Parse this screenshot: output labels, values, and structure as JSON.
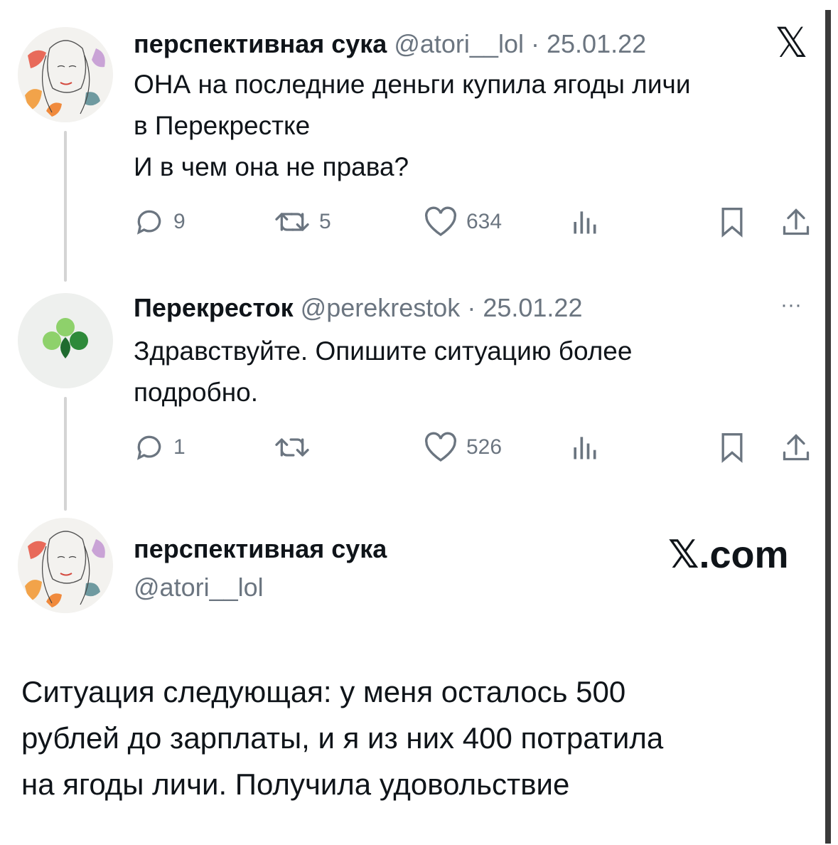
{
  "tweet1": {
    "display_name": "перспективная сука",
    "handle": "@atori__lol",
    "date": "25.01.22",
    "separator": "·",
    "lines": [
      "ОНА на последние деньги купила ягоды личи",
      "в Перекрестке",
      "И в чем она не права?"
    ],
    "replies": "9",
    "retweets": "5",
    "likes": "634"
  },
  "tweet2": {
    "display_name": "Перекресток",
    "handle": "@perekrestok",
    "date": "25.01.22",
    "separator": "·",
    "lines": [
      "Здравствуйте. Опишите ситуацию более",
      "подробно."
    ],
    "replies": "1",
    "retweets": "",
    "likes": "526",
    "more": "···"
  },
  "tweet3": {
    "display_name": "перспективная сука",
    "handle": "@atori__lol",
    "brand": "𝕏.com",
    "lines": [
      "Ситуация следующая: у меня осталось 500",
      "рублей до зарплаты, и я из них 400 потратила",
      "на ягоды личи. Получила удовольствие"
    ]
  },
  "x_logo": "𝕏",
  "colors": {
    "muted": "#6b7580",
    "text": "#0f1419",
    "clover_dark": "#1f6b2f",
    "clover_light": "#8ed16b"
  }
}
